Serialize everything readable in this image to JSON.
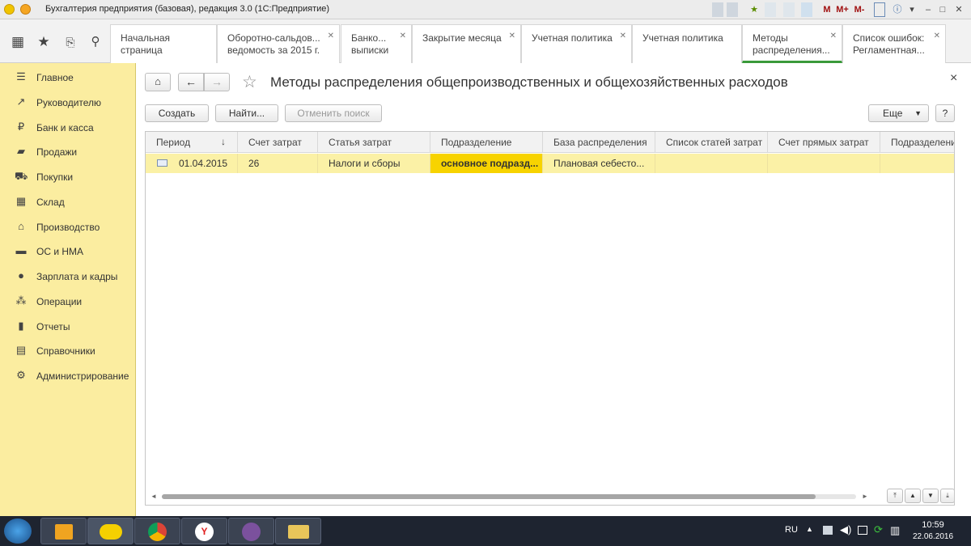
{
  "window": {
    "title": "Бухгалтерия предприятия (базовая), редакция 3.0  (1С:Предприятие)",
    "toolbar": [
      "M",
      "M+",
      "M-"
    ]
  },
  "tabs": [
    {
      "label": "Начальная страница",
      "closable": false
    },
    {
      "label": "Оборотно-сальдов... ведомость за 2015 г.",
      "closable": true
    },
    {
      "label": "Банко... выписки",
      "closable": true
    },
    {
      "label": "Закрытие месяца",
      "closable": true
    },
    {
      "label": "Учетная политика",
      "closable": true
    },
    {
      "label": "Учетная политика",
      "closable": false
    },
    {
      "label": "Методы распределения...",
      "closable": true,
      "active": true
    },
    {
      "label": "Список ошибок: Регламентная...",
      "closable": true
    }
  ],
  "sidebar": {
    "items": [
      {
        "label": "Главное",
        "icon": "list-icon"
      },
      {
        "label": "Руководителю",
        "icon": "trend-icon"
      },
      {
        "label": "Банк и касса",
        "icon": "ruble-icon"
      },
      {
        "label": "Продажи",
        "icon": "bag-icon"
      },
      {
        "label": "Покупки",
        "icon": "cart-icon"
      },
      {
        "label": "Склад",
        "icon": "warehouse-icon"
      },
      {
        "label": "Производство",
        "icon": "factory-icon"
      },
      {
        "label": "ОС и НМА",
        "icon": "truck-icon"
      },
      {
        "label": "Зарплата и кадры",
        "icon": "person-icon"
      },
      {
        "label": "Операции",
        "icon": "operations-icon"
      },
      {
        "label": "Отчеты",
        "icon": "chart-icon"
      },
      {
        "label": "Справочники",
        "icon": "book-icon"
      },
      {
        "label": "Администрирование",
        "icon": "gear-icon"
      }
    ]
  },
  "form": {
    "title": "Методы распределения общепроизводственных и общехозяйственных расходов",
    "buttons": {
      "create": "Создать",
      "find": "Найти...",
      "cancel_search": "Отменить поиск",
      "more": "Еще",
      "help": "?"
    },
    "close": "×"
  },
  "table": {
    "columns": [
      "Период",
      "Счет затрат",
      "Статья затрат",
      "Подразделение",
      "База распределения",
      "Список статей затрат",
      "Счет прямых затрат",
      "Подразделение"
    ],
    "rows": [
      [
        "01.04.2015",
        "26",
        "Налоги и сборы",
        "основное подразд...",
        "Плановая себесто...",
        "",
        "",
        ""
      ]
    ]
  },
  "taskbar": {
    "lang": "RU",
    "time": "10:59",
    "date": "22.06.2016"
  },
  "colors": {
    "sidebar": "#fbeda0",
    "row_selected": "#fbf1a6",
    "cell_current": "#f7d300",
    "active_tab": "#3a9a3a"
  }
}
